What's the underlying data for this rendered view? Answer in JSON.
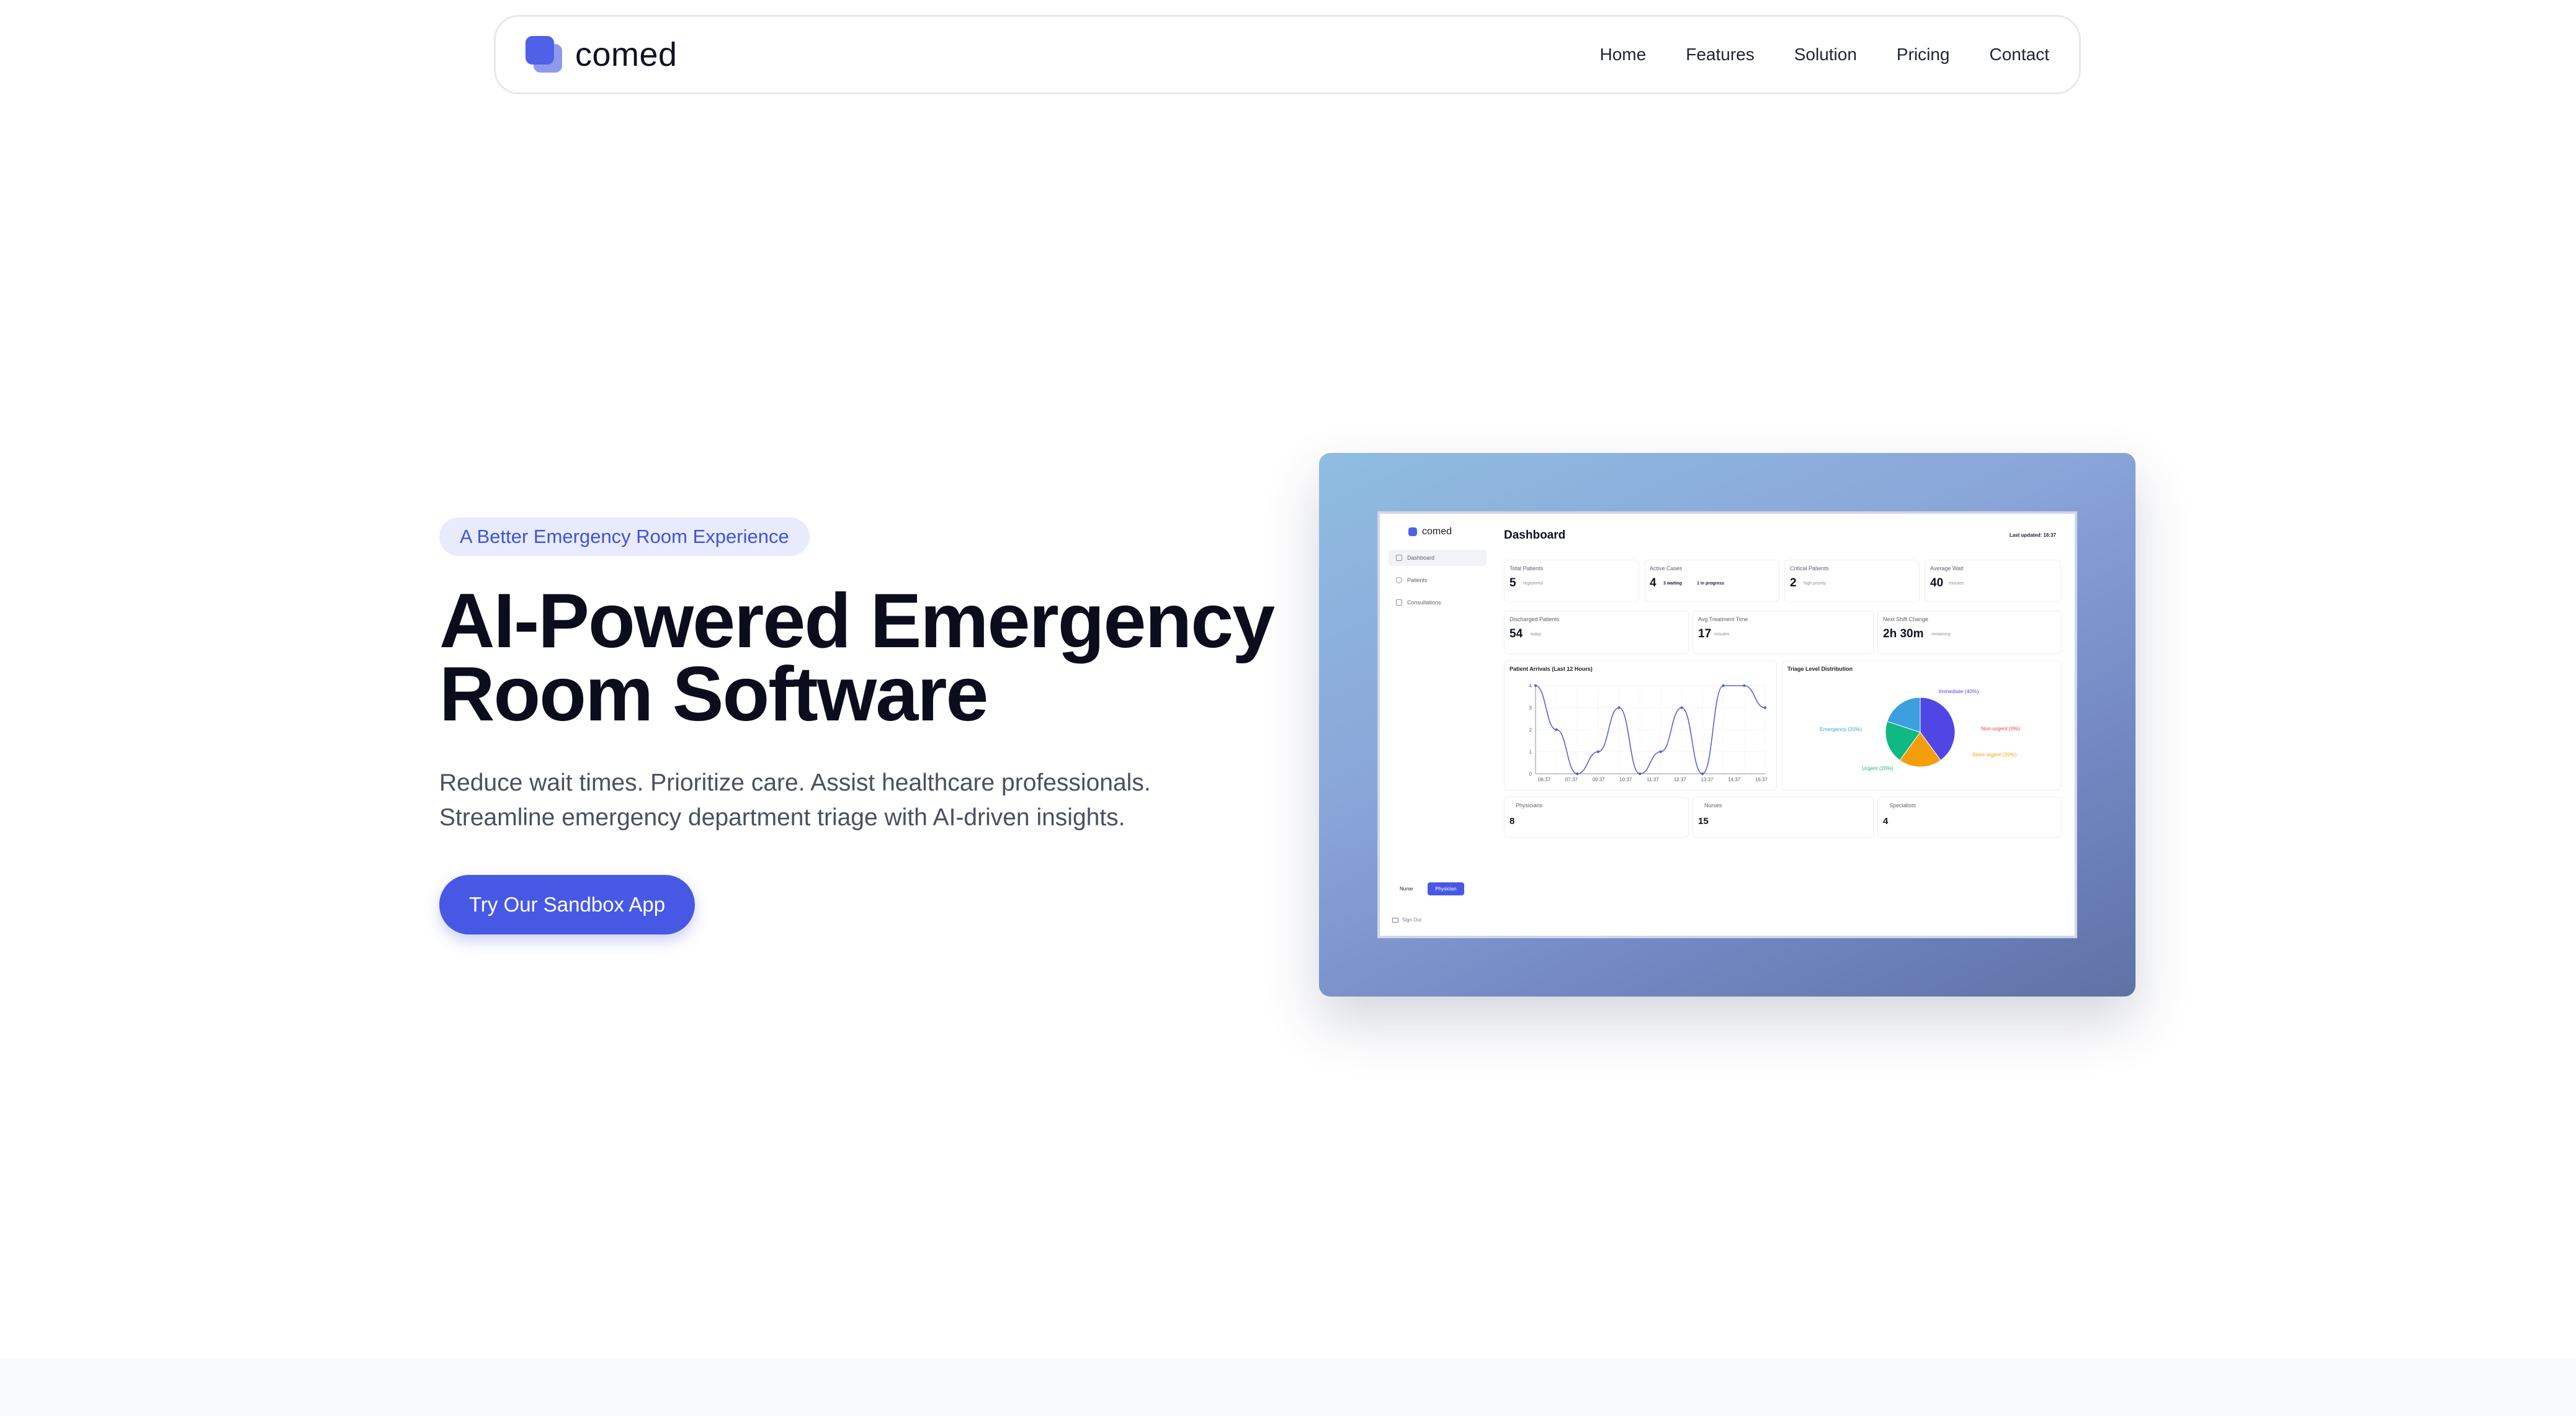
{
  "navbar": {
    "brand": "comed",
    "links": [
      "Home",
      "Features",
      "Solution",
      "Pricing",
      "Contact"
    ]
  },
  "hero": {
    "badge": "A Better Emergency Room Experience",
    "title_line1": "AI-Powered Emergency",
    "title_line2": "Room Software",
    "subtitle_line1": "Reduce wait times. Prioritize care. Assist healthcare professionals.",
    "subtitle_line2": "Streamline emergency department triage with AI-driven insights.",
    "cta_label": "Try Our Sandbox App"
  },
  "dashboard": {
    "brand": "comed",
    "title": "Dashboard",
    "last_updated": "Last updated: 16:37",
    "sidebar": [
      "Dashboard",
      "Patients",
      "Consultations"
    ],
    "roles": [
      "Nurse",
      "Physician"
    ],
    "active_role": "Physician",
    "sign_out": "Sign Out",
    "stats_row1": [
      {
        "label": "Total Patients",
        "value": "5",
        "unit": "registered"
      },
      {
        "label": "Active Cases",
        "value": "4",
        "unit": "3 waiting",
        "unit2": "1 in progress"
      },
      {
        "label": "Critical Patients",
        "value": "2",
        "unit": "high priority"
      },
      {
        "label": "Average Wait",
        "value": "40",
        "unit": "minutes"
      }
    ],
    "stats_row2": [
      {
        "label": "Discharged Patients",
        "value": "54",
        "unit": "today"
      },
      {
        "label": "Avg Treatment Time",
        "value": "17",
        "unit": "minutes"
      },
      {
        "label": "Next Shift Change",
        "value": "2h 30m",
        "unit": "remaining"
      }
    ],
    "staff": [
      {
        "label": "Physicians",
        "value": "8"
      },
      {
        "label": "Nurses",
        "value": "15"
      },
      {
        "label": "Specialists",
        "value": "4"
      }
    ],
    "line_title": "Patient Arrivals (Last 12 Hours)",
    "pie_title": "Triage Level Distribution"
  },
  "chart_data": [
    {
      "type": "line",
      "title": "Patient Arrivals (Last 12 Hours)",
      "x": [
        "06:37",
        "07:37",
        "08:37",
        "09:37",
        "10:37",
        "11:37",
        "12:37",
        "13:37",
        "14:37",
        "15:37",
        "16:37"
      ],
      "x_tick_labels": [
        "06:37",
        "07:37",
        "09:37",
        "10:37",
        "11:37",
        "12:37",
        "13:37",
        "14:37",
        "16:37"
      ],
      "series": [
        {
          "values": [
            4,
            2,
            0,
            1,
            3,
            0,
            1,
            3,
            0,
            4,
            4,
            3
          ]
        }
      ],
      "ylim": [
        0,
        4
      ],
      "yticks": [
        0,
        1,
        2,
        3,
        4
      ],
      "grid": true,
      "color": "#5563d8"
    },
    {
      "type": "pie",
      "title": "Triage Level Distribution",
      "slices": [
        {
          "label": "Immediate (40%)",
          "value": 40,
          "color": "#4f46e5"
        },
        {
          "label": "Non-urgent (0%)",
          "value": 0,
          "color": "#ef4444"
        },
        {
          "label": "Semi-urgent (20%)",
          "value": 20,
          "color": "#f59e0b"
        },
        {
          "label": "Urgent (20%)",
          "value": 20,
          "color": "#10b981"
        },
        {
          "label": "Emergency (20%)",
          "value": 20,
          "color": "#3b9fe0"
        }
      ]
    }
  ]
}
